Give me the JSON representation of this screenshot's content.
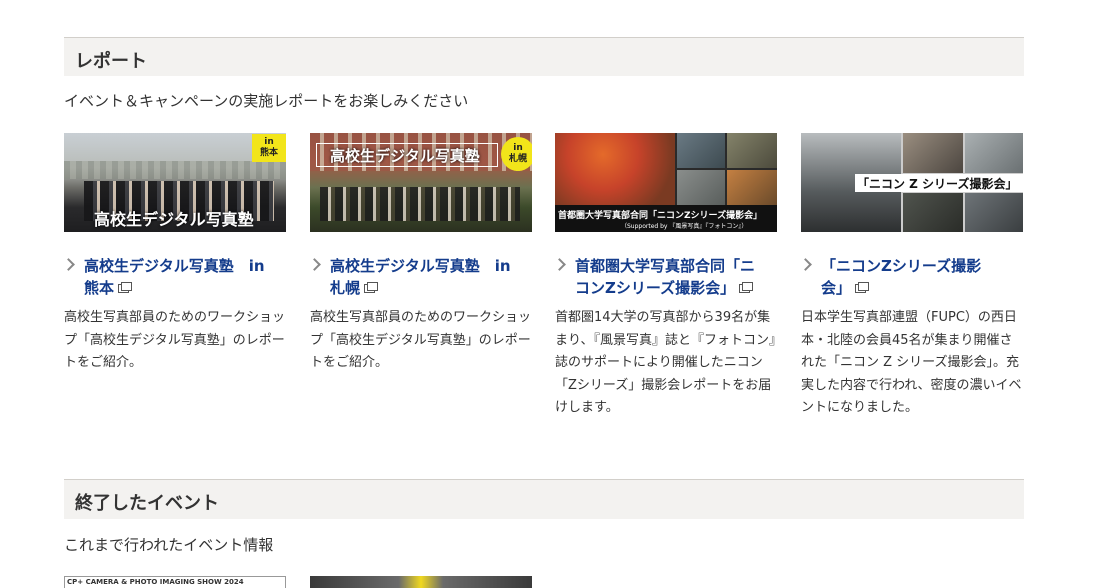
{
  "report": {
    "heading": "レポート",
    "intro": "イベント＆キャンペーンの実施レポートをお楽しみください",
    "cards": [
      {
        "title_line1": "高校生デジタル写真塾　in",
        "title_line2": "熊本",
        "desc": "高校生写真部員のためのワークショップ「高校生デジタル写真塾」のレポートをご紹介。",
        "thumb_caption": "高校生デジタル写真塾",
        "badge_line1": "in",
        "badge_line2": "熊本"
      },
      {
        "title_line1": "高校生デジタル写真塾　in",
        "title_line2": "札幌",
        "desc": "高校生写真部員のためのワークショップ「高校生デジタル写真塾」のレポートをご紹介。",
        "thumb_caption": "高校生デジタル写真塾",
        "badge_line1": "in",
        "badge_line2": "札幌"
      },
      {
        "title_line1": "首都圏大学写真部合同「ニ",
        "title_line2": "コンZシリーズ撮影会」",
        "desc": "首都圏14大学の写真部から39名が集まり、『風景写真』誌と『フォトコン』誌のサポートにより開催したニコン「Zシリーズ」撮影会レポートをお届けします。",
        "thumb_caption": "首都圏大学写真部合同「ニコンZシリーズ撮影会」",
        "thumb_sub": "（Supported by 『風景写真』『フォトコン』）"
      },
      {
        "title_line1": "「ニコンZシリーズ撮影",
        "title_line2": "会」",
        "desc": "日本学生写真部連盟（FUPC）の西日本・北陸の会員45名が集まり開催された「ニコン Z シリーズ撮影会」。充実した内容で行われ、密度の濃いイベントになりました。",
        "thumb_caption": "「ニコン Z シリーズ撮影会」"
      }
    ]
  },
  "ended": {
    "heading": "終了したイベント",
    "intro": "これまで行われたイベント情報",
    "thumb1_text": "CP+ CAMERA & PHOTO IMAGING SHOW 2024"
  }
}
